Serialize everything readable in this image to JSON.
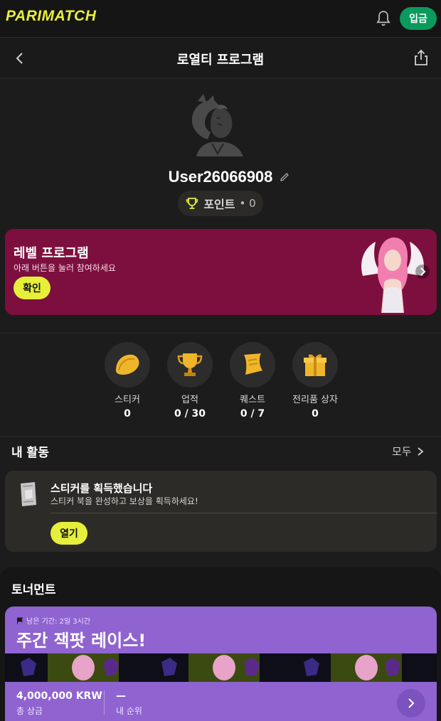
{
  "topbar": {
    "logo": "PARIMATCH",
    "deposit_label": "입금"
  },
  "header": {
    "title": "로열티 프로그램"
  },
  "profile": {
    "username": "User26066908",
    "points_label": "포인트",
    "points_value": "• 0"
  },
  "level_banner": {
    "title": "레벨 프로그램",
    "subtitle": "아래 버튼을 눌러 참여하세요",
    "button": "확인"
  },
  "stats": [
    {
      "label": "스티커",
      "value": "0"
    },
    {
      "label": "업적",
      "value": "0 / 30"
    },
    {
      "label": "퀘스트",
      "value": "0 / 7"
    },
    {
      "label": "전리품 상자",
      "value": "0"
    }
  ],
  "activity": {
    "title": "내 활동",
    "see_all": "모두",
    "card_title": "스티커를 획득했습니다",
    "card_subtitle": "스티커 북을 완성하고 보상을 획득하세요!",
    "button": "열기"
  },
  "tournament": {
    "section_title": "토너먼트",
    "remaining": "남은 기간: 2일 3시간",
    "title": "주간 잭팟 레이스!",
    "prize": "4,000,000 KRW",
    "prize_label": "총 상금",
    "rank": "—",
    "rank_label": "내 순위"
  },
  "colors": {
    "accent": "#e6ef3a",
    "deposit": "#0a9a5e",
    "banner": "#7d0f3e",
    "tournament": "#8f63d0"
  }
}
